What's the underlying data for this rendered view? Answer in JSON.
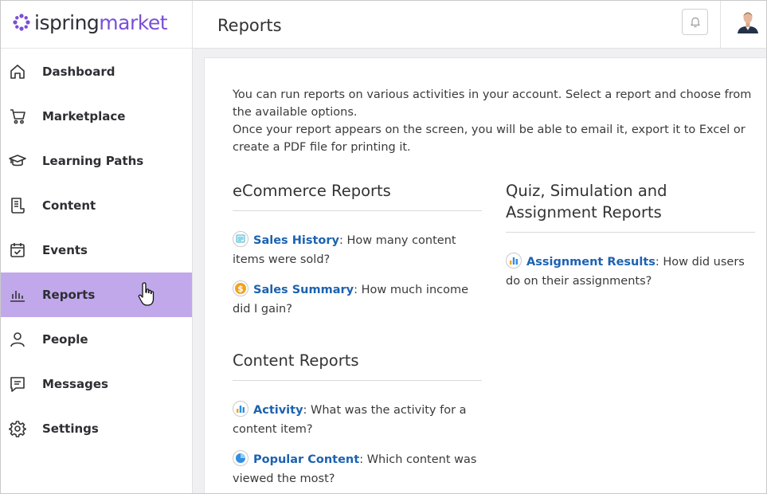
{
  "brand": {
    "name_part1": "ispring",
    "name_part2": "market",
    "accent_color": "#7a4fd6"
  },
  "header": {
    "title": "Reports"
  },
  "sidebar": {
    "items": [
      {
        "label": "Dashboard",
        "icon": "home-icon"
      },
      {
        "label": "Marketplace",
        "icon": "cart-icon"
      },
      {
        "label": "Learning Paths",
        "icon": "graduation-cap-icon"
      },
      {
        "label": "Content",
        "icon": "document-icon"
      },
      {
        "label": "Events",
        "icon": "calendar-check-icon"
      },
      {
        "label": "Reports",
        "icon": "bar-chart-icon",
        "active": true
      },
      {
        "label": "People",
        "icon": "person-icon"
      },
      {
        "label": "Messages",
        "icon": "message-icon"
      },
      {
        "label": "Settings",
        "icon": "gear-icon"
      }
    ],
    "active_color": "#c1a8eb"
  },
  "main": {
    "intro_line1": "You can run reports on various activities in your account. Select a report and choose from the available options.",
    "intro_line2": "Once your report appears on the screen, you will be able to email it, export it to Excel or create a PDF file for printing it.",
    "ecommerce": {
      "title": "eCommerce Reports",
      "reports": [
        {
          "link": "Sales History",
          "desc": ": How many content items were sold?"
        },
        {
          "link": "Sales Summary",
          "desc": ": How much income did I gain?"
        }
      ]
    },
    "content": {
      "title": "Content Reports",
      "reports": [
        {
          "link": "Activity",
          "desc": ": What was the activity for a content item?"
        },
        {
          "link": "Popular Content",
          "desc": ": Which content was viewed the most?"
        }
      ]
    },
    "quiz": {
      "title": "Quiz, Simulation and Assignment Reports",
      "reports": [
        {
          "link": "Assignment Results",
          "desc": ": How did users do on their assignments?"
        }
      ]
    }
  }
}
